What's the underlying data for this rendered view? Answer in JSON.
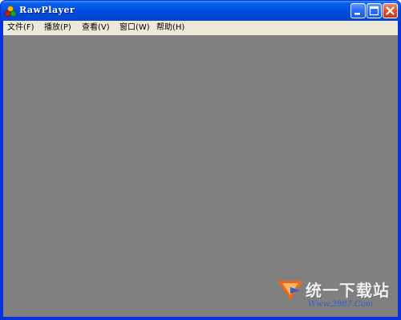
{
  "window": {
    "title": "RawPlayer",
    "title_color": "#ffffff",
    "titlebar_color": "#0050e6",
    "client_background": "#808080",
    "controls": {
      "minimize_icon": "minimize-icon",
      "maximize_icon": "maximize-icon",
      "close_icon": "close-icon"
    }
  },
  "menu": {
    "items": [
      {
        "label": "文件",
        "accel": "(F)"
      },
      {
        "label": "播放",
        "accel": "(P)"
      },
      {
        "label": "查看",
        "accel": "(V)"
      },
      {
        "label": "窗口",
        "accel": "(W)"
      },
      {
        "label": "帮助",
        "accel": "(H)"
      }
    ]
  },
  "watermark": {
    "text": "统一下载站",
    "url": "Www.3987.Com"
  }
}
